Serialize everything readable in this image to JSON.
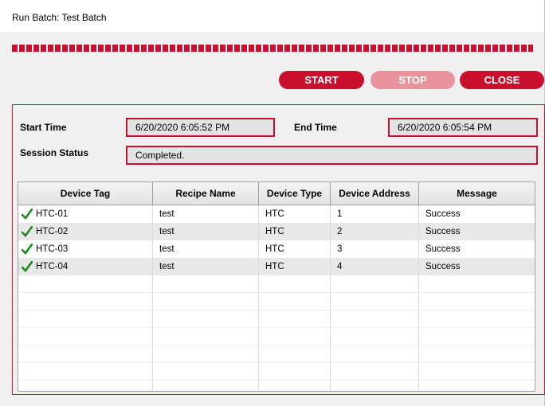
{
  "window": {
    "title": "Run Batch: Test Batch"
  },
  "progress": {
    "fraction": 1.0
  },
  "toolbar": {
    "start_label": "START",
    "stop_label": "STOP",
    "close_label": "CLOSE"
  },
  "session": {
    "start_time_label": "Start Time",
    "start_time_value": "6/20/2020 6:05:52 PM",
    "end_time_label": "End Time",
    "end_time_value": "6/20/2020 6:05:54 PM",
    "status_label": "Session Status",
    "status_value": "Completed."
  },
  "table": {
    "columns": [
      "Device Tag",
      "Recipe Name",
      "Device Type",
      "Device Address",
      "Message"
    ],
    "rows": [
      [
        "HTC-01",
        "test",
        "HTC",
        "1",
        "Success"
      ],
      [
        "HTC-02",
        "test",
        "HTC",
        "2",
        "Success"
      ],
      [
        "HTC-03",
        "test",
        "HTC",
        "3",
        "Success"
      ],
      [
        "HTC-04",
        "test",
        "HTC",
        "4",
        "Success"
      ]
    ],
    "row_icon": "checkmark-icon"
  },
  "colors": {
    "accent": "#c8102e",
    "disabled": "#e8939e",
    "check": "#1f8a1f"
  }
}
